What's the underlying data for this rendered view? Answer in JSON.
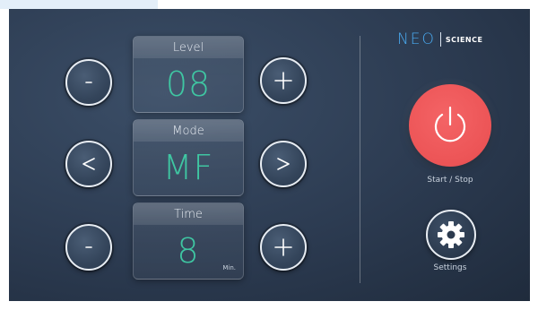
{
  "brand": {
    "neo": "NEO",
    "science": "SCIENCE",
    "accent_color": "#49a8ee"
  },
  "controls": {
    "level": {
      "title": "Level",
      "value": "08",
      "decrease_icon": "minus-icon",
      "increase_icon": "plus-icon"
    },
    "mode": {
      "title": "Mode",
      "value": "MF",
      "previous_icon": "chevron-left-icon",
      "next_icon": "chevron-right-icon"
    },
    "time": {
      "title": "Time",
      "value": "8",
      "unit": "Min.",
      "decrease_icon": "minus-icon",
      "increase_icon": "plus-icon"
    }
  },
  "power": {
    "label": "Start / Stop",
    "icon": "power-icon",
    "color": "#ec5456"
  },
  "settings": {
    "label": "Settings",
    "icon": "gear-icon"
  },
  "colors": {
    "value_text": "#3fc6a2",
    "background": "#2c3b51"
  }
}
